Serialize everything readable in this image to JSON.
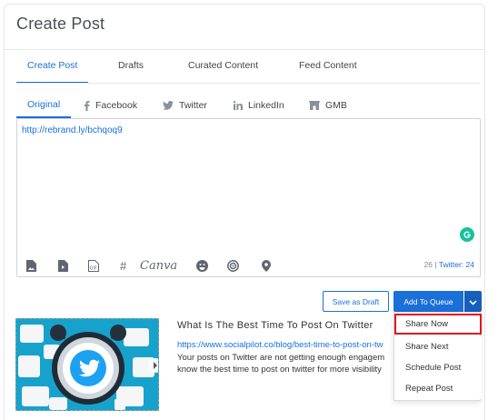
{
  "header": {
    "title": "Create Post"
  },
  "main_tabs": [
    {
      "label": "Create Post",
      "active": true
    },
    {
      "label": "Drafts",
      "active": false
    },
    {
      "label": "Curated Content",
      "active": false
    },
    {
      "label": "Feed Content",
      "active": false
    }
  ],
  "network_tabs": [
    {
      "label": "Original",
      "icon": "none",
      "active": true
    },
    {
      "label": "Facebook",
      "icon": "facebook-icon",
      "active": false
    },
    {
      "label": "Twitter",
      "icon": "twitter-icon",
      "active": false
    },
    {
      "label": "LinkedIn",
      "icon": "linkedin-icon",
      "active": false
    },
    {
      "label": "GMB",
      "icon": "gmb-icon",
      "active": false
    }
  ],
  "editor": {
    "content": "http://rebrand.ly/bchqoq9",
    "toolbar": [
      {
        "name": "image-upload-icon"
      },
      {
        "name": "video-upload-icon"
      },
      {
        "name": "gif-icon"
      },
      {
        "name": "hashtag-icon",
        "glyph": "#"
      },
      {
        "name": "canva-icon",
        "text": "Canva"
      },
      {
        "name": "emoji-icon"
      },
      {
        "name": "target-icon"
      },
      {
        "name": "location-icon"
      }
    ],
    "char_count": "26",
    "separator": "|",
    "twitter_count": "Twitter: 24"
  },
  "actions": {
    "save_draft": "Save as Draft",
    "add_to_queue": "Add To Queue"
  },
  "link_preview": {
    "title": "What Is The Best Time To Post On Twitter",
    "url": "https://www.socialpilot.co/blog/best-time-to-post-on-tw",
    "description_lines": [
      "Your posts on Twitter are not getting enough engagem",
      "know the best time to post on twitter for more visibility"
    ]
  },
  "dropdown": {
    "items": [
      {
        "label": "Share Now",
        "highlighted": true
      },
      {
        "label": "Share Next",
        "highlighted": false
      },
      {
        "label": "Schedule Post",
        "highlighted": false
      },
      {
        "label": "Repeat Post",
        "highlighted": false
      }
    ]
  },
  "colors": {
    "accent": "#1b6fd8",
    "highlight_border": "#e0161e",
    "grammarly": "#15c39a",
    "preview_bg": "#1aa0c8"
  }
}
